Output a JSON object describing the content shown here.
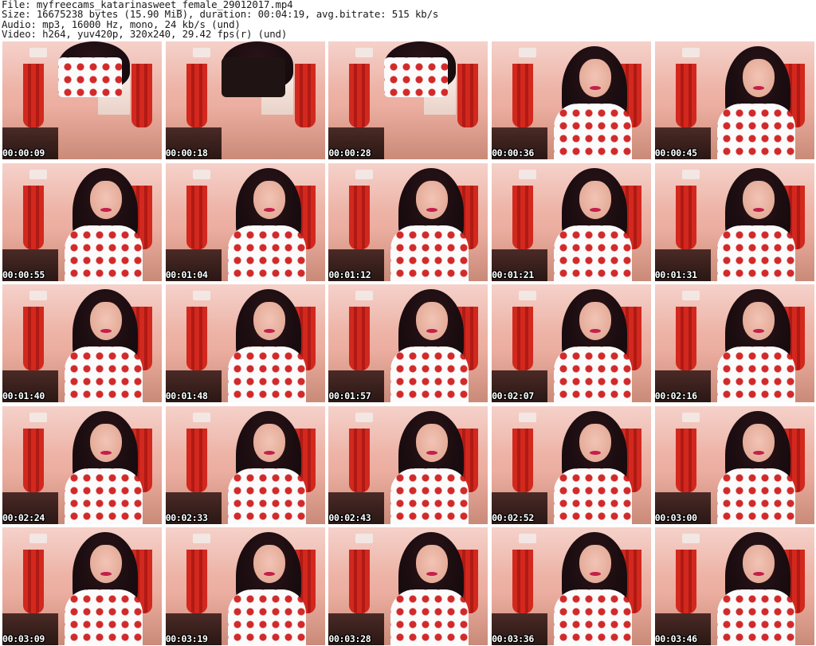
{
  "header": {
    "file_line": "File: myfreecams_katarinasweet_female_29012017.mp4",
    "size_line": "Size: 16675238 bytes (15.90 MiB), duration: 00:04:19, avg.bitrate: 515 kb/s",
    "audio_line": "Audio: mp3, 16000 Hz, mono, 24 kb/s (und)",
    "video_line": "Video: h264, yuv420p, 320x240, 29.42 fps(r) (und)"
  },
  "thumbnails": [
    {
      "time": "00:00:09",
      "variant": "alt"
    },
    {
      "time": "00:00:18",
      "variant": "dark"
    },
    {
      "time": "00:00:28",
      "variant": "alt"
    },
    {
      "time": "00:00:36",
      "variant": "normal"
    },
    {
      "time": "00:00:45",
      "variant": "normal"
    },
    {
      "time": "00:00:55",
      "variant": "normal"
    },
    {
      "time": "00:01:04",
      "variant": "normal"
    },
    {
      "time": "00:01:12",
      "variant": "normal"
    },
    {
      "time": "00:01:21",
      "variant": "normal"
    },
    {
      "time": "00:01:31",
      "variant": "normal"
    },
    {
      "time": "00:01:40",
      "variant": "normal"
    },
    {
      "time": "00:01:48",
      "variant": "normal"
    },
    {
      "time": "00:01:57",
      "variant": "normal"
    },
    {
      "time": "00:02:07",
      "variant": "normal"
    },
    {
      "time": "00:02:16",
      "variant": "normal"
    },
    {
      "time": "00:02:24",
      "variant": "normal"
    },
    {
      "time": "00:02:33",
      "variant": "normal"
    },
    {
      "time": "00:02:43",
      "variant": "normal"
    },
    {
      "time": "00:02:52",
      "variant": "normal"
    },
    {
      "time": "00:03:00",
      "variant": "normal"
    },
    {
      "time": "00:03:09",
      "variant": "normal"
    },
    {
      "time": "00:03:19",
      "variant": "normal"
    },
    {
      "time": "00:03:28",
      "variant": "normal"
    },
    {
      "time": "00:03:36",
      "variant": "normal"
    },
    {
      "time": "00:03:46",
      "variant": "normal"
    }
  ]
}
